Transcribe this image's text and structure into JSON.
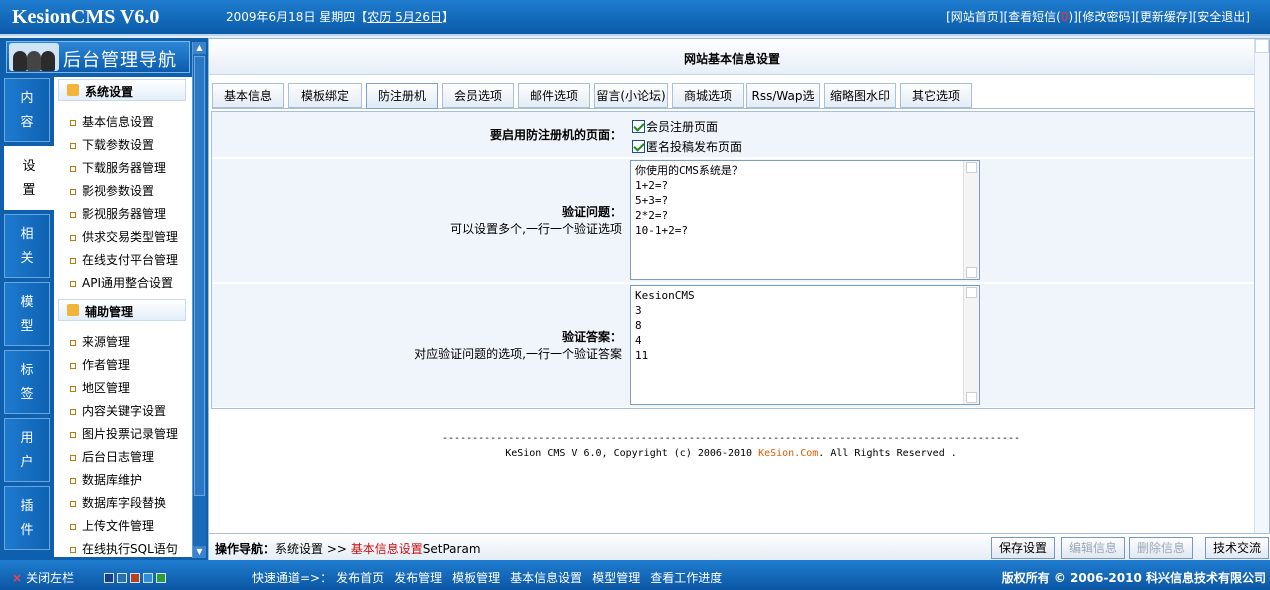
{
  "header": {
    "app_title": "KesionCMS V6.0",
    "date_prefix": "2009年6月18日 星期四",
    "lunar_open": "【",
    "lunar": "农历 5月26日",
    "lunar_close": "】",
    "links": {
      "home": "[网站首页]",
      "messages_pre": "[查看短信(",
      "messages_count": "0",
      "messages_post": ")]",
      "change_password": "[修改密码]",
      "update_cache": "[更新缓存]",
      "logout": "[安全退出]"
    }
  },
  "sidebar": {
    "title": "后台管理导航",
    "tabs": [
      "内容",
      "设置",
      "相关",
      "模型",
      "标签",
      "用户",
      "插件"
    ],
    "active_tab": "设置",
    "groups": [
      {
        "title": "系统设置",
        "items": [
          "基本信息设置",
          "下载参数设置",
          "下载服务器管理",
          "影视参数设置",
          "影视服务器管理",
          "供求交易类型管理",
          "在线支付平台管理",
          "API通用整合设置"
        ]
      },
      {
        "title": "辅助管理",
        "items": [
          "来源管理",
          "作者管理",
          "地区管理",
          "内容关键字设置",
          "图片投票记录管理",
          "后台日志管理",
          "数据库维护",
          "数据库字段替换",
          "上传文件管理",
          "在线执行SQL语句"
        ]
      }
    ]
  },
  "main": {
    "title": "网站基本信息设置",
    "tabs": [
      "基本信息",
      "模板绑定",
      "防注册机",
      "会员选项",
      "邮件选项",
      "留言(小论坛)",
      "商城选项",
      "Rss/Wap选项",
      "缩略图水印",
      "其它选项"
    ],
    "active_tab": "防注册机",
    "form": {
      "pages_label": "要启用防注册机的页面：",
      "checkbox_member": "会员注册页面",
      "checkbox_anonymous": "匿名投稿发布页面",
      "question_label": "验证问题：",
      "question_hint": "可以设置多个,一行一个验证选项",
      "question_value": "你使用的CMS系统是？\n1+2=?\n5+3=?\n2*2=?\n10-1+2=?",
      "answer_label": "验证答案：",
      "answer_hint": "对应验证问题的选项,一行一个验证答案",
      "answer_value": "KesionCMS\n3\n8\n4\n11"
    },
    "footer": {
      "dashes": "------------------------------------------------------------------------------------------------",
      "copyright_pre": "KeSion CMS V 6.0, Copyright (c) 2006-2010 ",
      "brand": "KeSion.Com",
      "copyright_post": ". All Rights Reserved ."
    }
  },
  "opbar": {
    "nav_label": "操作导航：",
    "nav_path": "系统设置 >> ",
    "nav_current": "基本信息设置",
    "nav_suffix": "SetParam",
    "buttons": [
      "保存设置",
      "编辑信息",
      "删除信息",
      "技术交流"
    ]
  },
  "bottombar": {
    "close_left": "关闭左栏",
    "swatch_colors": [
      "#1a3f8a",
      "#2a6fb3",
      "#b8431a",
      "#2e8fd8",
      "#2f9a3a"
    ],
    "quick_label": "快速通道=>：",
    "quick_links": [
      "发布首页",
      "发布管理",
      "模板管理",
      "基本信息设置",
      "模型管理",
      "查看工作进度"
    ],
    "copyright": "版权所有 © 2006-2010 科兴信息技术有限公司"
  }
}
